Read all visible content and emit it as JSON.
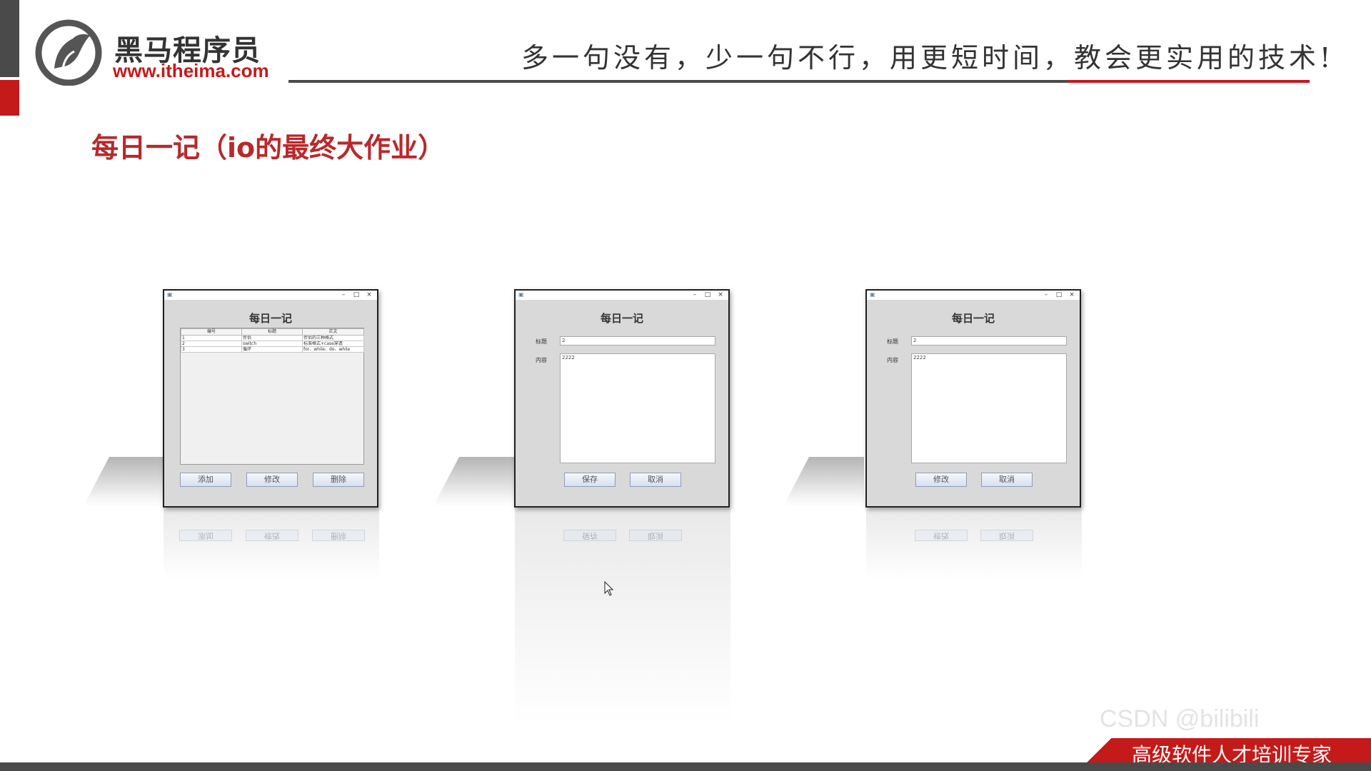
{
  "header": {
    "logo_cn": "黑马程序员",
    "logo_url": "www.itheima.com",
    "slogan": "多一句没有，少一句不行，用更短时间，教会更实用的技术!"
  },
  "page_title": "每日一记（io的最终大作业）",
  "windows": {
    "list": {
      "heading": "每日一记",
      "columns": [
        "编号",
        "标题",
        "正文"
      ],
      "rows": [
        [
          "1",
          "伴侣",
          "伴侣的三种格式"
        ],
        [
          "2",
          "switch",
          "标准格式+case穿透"
        ],
        [
          "3",
          "循环",
          "for、while、do、while"
        ]
      ],
      "buttons": [
        "添加",
        "修改",
        "删除"
      ]
    },
    "add": {
      "heading": "每日一记",
      "title_label": "标题",
      "title_value": "2",
      "content_label": "内容",
      "content_value": "2222",
      "buttons": [
        "保存",
        "取消"
      ]
    },
    "edit": {
      "heading": "每日一记",
      "title_label": "标题",
      "title_value": "2",
      "content_label": "内容",
      "content_value": "2222",
      "buttons": [
        "修改",
        "取消"
      ]
    }
  },
  "titlebar_controls": [
    "–",
    "□",
    "×"
  ],
  "footer": {
    "banner_text": "高级软件人才培训专家",
    "watermark": "CSDN @bilibili"
  }
}
